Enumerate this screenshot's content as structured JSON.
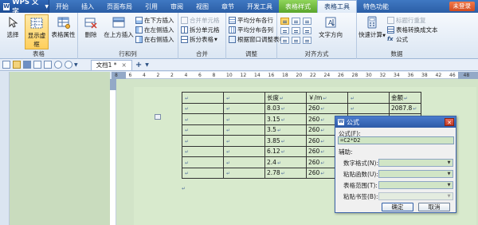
{
  "app": {
    "name": "WPS 文字",
    "logo": "W",
    "login_label": "未登录"
  },
  "menu": {
    "tabs": [
      "开始",
      "插入",
      "页面布局",
      "引用",
      "审阅",
      "视图",
      "章节",
      "开发工具",
      "表格样式",
      "表格工具",
      "特色功能"
    ],
    "active_tab": "表格工具"
  },
  "ribbon": {
    "table_group": {
      "label": "表格",
      "select_label": "选择",
      "gridlines_label": "显示虚框",
      "properties_label": "表格属性"
    },
    "rowcol_group": {
      "label": "行和列",
      "delete_label": "删除",
      "insert_above_label": "在上方插入",
      "insert_below_label": "在下方插入",
      "insert_left_label": "在左侧插入",
      "insert_right_label": "在右侧插入"
    },
    "merge_group": {
      "label": "合并",
      "merge_cells_label": "合并单元格",
      "split_cells_label": "拆分单元格",
      "split_table_label": "拆分表格"
    },
    "adjust_group": {
      "label": "调整",
      "dist_rows_label": "平均分布各行",
      "dist_cols_label": "平均分布各列",
      "autofit_label": "根据窗口调整表格"
    },
    "align_group": {
      "label": "对齐方式",
      "text_direction_label": "文字方向"
    },
    "data_group": {
      "label": "数据",
      "quick_calc_label": "快速计算",
      "repeat_header_label": "标题行重复",
      "convert_label": "表格转换成文本",
      "formula_label": "公式"
    }
  },
  "tabbar": {
    "doc_tab_label": "文档1 *",
    "close_glyph": "×",
    "new_tab_glyph": "+"
  },
  "ruler": {
    "numbers": [
      "8",
      "6",
      "4",
      "2",
      "2",
      "4",
      "6",
      "8",
      "10",
      "12",
      "14",
      "16",
      "18",
      "20",
      "22",
      "24",
      "26",
      "28",
      "30",
      "32",
      "34",
      "36",
      "38",
      "42",
      "46",
      "48"
    ]
  },
  "table": {
    "rows": [
      [
        "",
        "",
        "长度",
        "￥/m",
        "",
        "金额"
      ],
      [
        "",
        "",
        "8.03",
        "260",
        "",
        "2087.8"
      ],
      [
        "",
        "",
        "3.15",
        "260",
        "",
        ""
      ],
      [
        "",
        "",
        "3.5",
        "260",
        "",
        ""
      ],
      [
        "",
        "",
        "3.85",
        "260",
        "",
        ""
      ],
      [
        "",
        "",
        "6.12",
        "260",
        "",
        ""
      ],
      [
        "",
        "",
        "2.4",
        "260",
        "",
        ""
      ],
      [
        "",
        "",
        "2.78",
        "260",
        "",
        ""
      ]
    ],
    "cell_mark": "↵"
  },
  "dialog": {
    "title": "公式",
    "title_logo": "W",
    "close_glyph": "✕",
    "formula_label": "公式(F):",
    "formula_value": "=C2*D2",
    "helper_label": "辅助:",
    "number_format_label": "数字格式(N):",
    "paste_function_label": "粘贴函数(U):",
    "table_range_label": "表格范围(T):",
    "paste_bookmark_label": "粘贴书签(B):",
    "ok_label": "确定",
    "cancel_label": "取消"
  }
}
